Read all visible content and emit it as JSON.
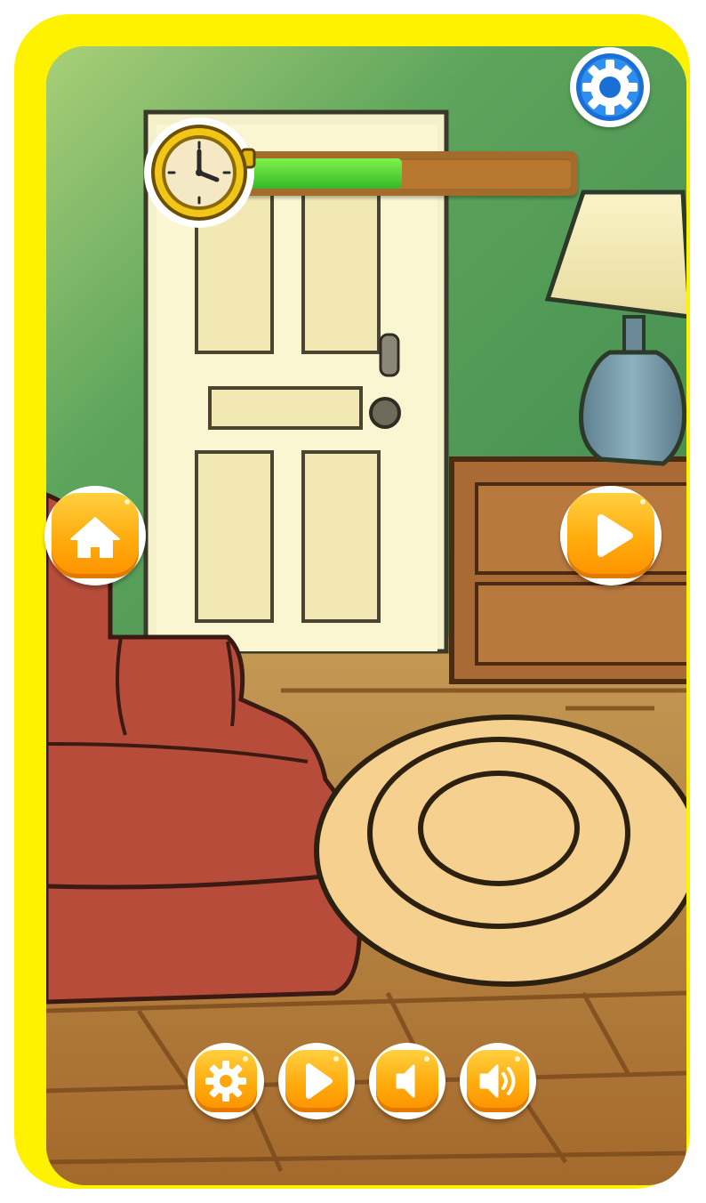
{
  "game": {
    "scene": "living-room",
    "timer": {
      "progress": 0.48,
      "fill_color": "#4fd53a",
      "track_color": "#b9782f"
    },
    "clock_icon": "stopwatch-icon",
    "buttons": {
      "top_settings": {
        "icon": "gear-icon",
        "color": "#1f7fe0"
      },
      "home": {
        "icon": "home-icon"
      },
      "next": {
        "icon": "play-icon"
      },
      "bottom": [
        {
          "icon": "gear-icon"
        },
        {
          "icon": "play-icon"
        },
        {
          "icon": "sound-off-icon"
        },
        {
          "icon": "sound-on-icon"
        }
      ]
    }
  },
  "colors": {
    "frame": "#fff200",
    "wall": "#5e9c5a",
    "button_orange": "#ffab0c",
    "sofa": "#b84c3a",
    "rug": "#f6d08e",
    "floor": "#b58440"
  }
}
